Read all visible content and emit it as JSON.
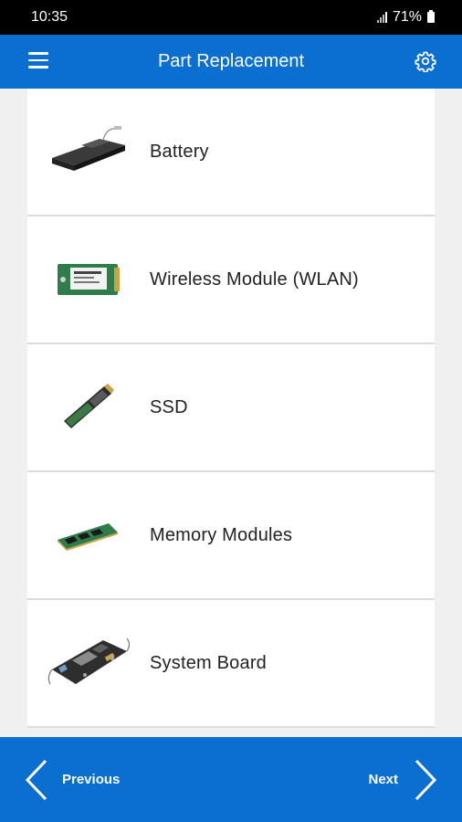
{
  "status_bar": {
    "time": "10:35",
    "battery": "71%"
  },
  "app_bar": {
    "title": "Part Replacement"
  },
  "parts": [
    {
      "label": "Battery",
      "icon": "battery-part-icon"
    },
    {
      "label": "Wireless Module  (WLAN)",
      "icon": "wlan-card-icon"
    },
    {
      "label": "SSD",
      "icon": "ssd-icon"
    },
    {
      "label": "Memory Modules",
      "icon": "memory-module-icon"
    },
    {
      "label": "System Board",
      "icon": "system-board-icon"
    }
  ],
  "bottom_bar": {
    "previous_label": "Previous",
    "next_label": "Next"
  },
  "colors": {
    "primary": "#0a6fd0",
    "background": "#f0f0f0",
    "card": "#ffffff"
  }
}
